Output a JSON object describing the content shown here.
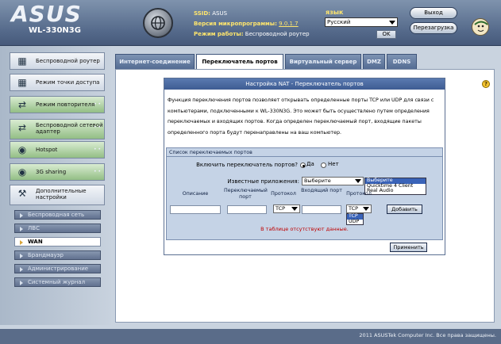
{
  "header": {
    "logo": "ASUS",
    "model": "WL-330N3G",
    "ssid_label": "SSID:",
    "ssid_value": "ASUS",
    "fw_label": "Версия микропрограммы:",
    "fw_value": "9.0.1.7",
    "mode_label": "Режим работы:",
    "mode_value": "Беспроводной роутер",
    "lang_label": "язык",
    "lang_value": "Русский",
    "ok_label": "OK",
    "logout_label": "Выход",
    "reboot_label": "Перезагрузка"
  },
  "sidebar": {
    "modes": [
      {
        "label": "Беспроводной роутер",
        "icon": "router-icon"
      },
      {
        "label": "Режим точки доступа",
        "icon": "access-point-icon"
      },
      {
        "label": "Режим повторителя",
        "icon": "repeater-icon"
      },
      {
        "label": "Беспроводной сетевой адаптер",
        "icon": "adapter-icon"
      },
      {
        "label": "Hotspot",
        "icon": "hotspot-icon"
      },
      {
        "label": "3G sharing",
        "icon": "3g-icon"
      },
      {
        "label": "Дополнительные настройки",
        "icon": "wrench-icon"
      }
    ],
    "subitems": [
      {
        "label": "Беспроводная сеть"
      },
      {
        "label": "ЛВС"
      },
      {
        "label": "WAN"
      },
      {
        "label": "Брандмауэр"
      },
      {
        "label": "Администрирование"
      },
      {
        "label": "Системный журнал"
      }
    ],
    "active_sub": "WAN"
  },
  "tabs": [
    {
      "label": "Интернет-соединение"
    },
    {
      "label": "Переключатель портов"
    },
    {
      "label": "Виртуальный сервер"
    },
    {
      "label": "DMZ"
    },
    {
      "label": "DDNS"
    }
  ],
  "active_tab": "Переключатель портов",
  "panel": {
    "title": "Настройка NAT - Переключатель портов",
    "description": "Функция переключения портов позволяет открывать определенные порты TCP или UDP для связи с компьютерами, подключенными к WL-330N3G. Это может быть осуществлено путем определения переключаемых и входящих портов. Когда определен переключаемый порт, входящие пакеты определенного порта будут перенаправлены на ваш компьютер.",
    "list_title": "Список переключаемых портов",
    "enable_label": "Включить переключатель портов?",
    "yes_label": "Да",
    "no_label": "Нет",
    "apps_label": "Известные приложения:",
    "apps_selected": "Выберите",
    "apps_options": [
      "Выберите",
      "Quicktime 4 Client",
      "Real Audio"
    ],
    "columns": {
      "description": "Описание",
      "trigger_port": "Переключаемый порт",
      "protocol": "Протокол",
      "incoming_port": "Входящий порт",
      "protocol2": "Протокол"
    },
    "protocol_value": "TCP",
    "protocol2_value": "TCP",
    "protocol_options": [
      "TCP",
      "UDP"
    ],
    "add_label": "Добавить",
    "no_data": "В таблице отсутствуют данные.",
    "apply_label": "Применить"
  },
  "footer": {
    "copyright": "2011 ASUSTek Computer Inc. Все права защищены."
  },
  "colors": {
    "header_bg": "#54698a",
    "panel_title_bg": "#3e5c93",
    "tab_bg": "#546c93",
    "no_data_text": "#c00000"
  }
}
